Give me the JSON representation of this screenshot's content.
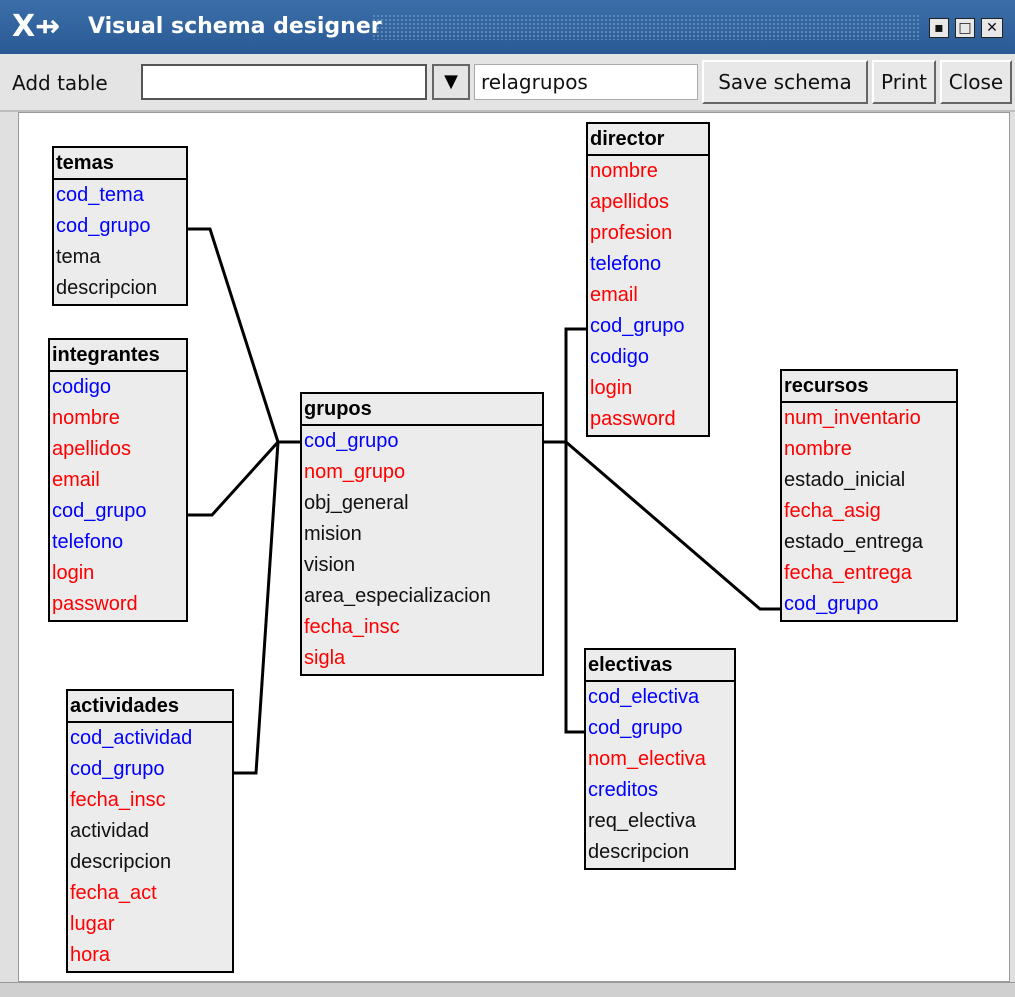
{
  "window": {
    "title": "Visual schema designer",
    "logo": "X⇸",
    "buttons": [
      "▪",
      "□",
      "✕"
    ]
  },
  "toolbar": {
    "add_table_label": "Add table",
    "add_table_value": "",
    "dropdown_icon": "▼",
    "relation_value": "relagrupos",
    "save_label": "Save schema",
    "print_label": "Print",
    "close_label": "Close"
  },
  "colors": {
    "key": "#0000ff",
    "required": "#ff0000",
    "optional": "#111111"
  },
  "tables": [
    {
      "name": "temas",
      "fields": [
        {
          "name": "cod_tema",
          "type": "key"
        },
        {
          "name": "cod_grupo",
          "type": "key"
        },
        {
          "name": "tema",
          "type": "optional"
        },
        {
          "name": "descripcion",
          "type": "optional"
        }
      ]
    },
    {
      "name": "integrantes",
      "fields": [
        {
          "name": "codigo",
          "type": "key"
        },
        {
          "name": "nombre",
          "type": "required"
        },
        {
          "name": "apellidos",
          "type": "required"
        },
        {
          "name": "email",
          "type": "required"
        },
        {
          "name": "cod_grupo",
          "type": "key"
        },
        {
          "name": "telefono",
          "type": "key"
        },
        {
          "name": "login",
          "type": "required"
        },
        {
          "name": "password",
          "type": "required"
        }
      ]
    },
    {
      "name": "actividades",
      "fields": [
        {
          "name": "cod_actividad",
          "type": "key"
        },
        {
          "name": "cod_grupo",
          "type": "key"
        },
        {
          "name": "fecha_insc",
          "type": "required"
        },
        {
          "name": "actividad",
          "type": "optional"
        },
        {
          "name": "descripcion",
          "type": "optional"
        },
        {
          "name": "fecha_act",
          "type": "required"
        },
        {
          "name": "lugar",
          "type": "required"
        },
        {
          "name": "hora",
          "type": "required"
        }
      ]
    },
    {
      "name": "grupos",
      "fields": [
        {
          "name": "cod_grupo",
          "type": "key"
        },
        {
          "name": "nom_grupo",
          "type": "required"
        },
        {
          "name": "obj_general",
          "type": "optional"
        },
        {
          "name": "mision",
          "type": "optional"
        },
        {
          "name": "vision",
          "type": "optional"
        },
        {
          "name": "area_especializacion",
          "type": "optional"
        },
        {
          "name": "fecha_insc",
          "type": "required"
        },
        {
          "name": "sigla",
          "type": "required"
        }
      ]
    },
    {
      "name": "director",
      "fields": [
        {
          "name": "nombre",
          "type": "required"
        },
        {
          "name": "apellidos",
          "type": "required"
        },
        {
          "name": "profesion",
          "type": "required"
        },
        {
          "name": "telefono",
          "type": "key"
        },
        {
          "name": "email",
          "type": "required"
        },
        {
          "name": "cod_grupo",
          "type": "key"
        },
        {
          "name": "codigo",
          "type": "key"
        },
        {
          "name": "login",
          "type": "required"
        },
        {
          "name": "password",
          "type": "required"
        }
      ]
    },
    {
      "name": "recursos",
      "fields": [
        {
          "name": "num_inventario",
          "type": "required"
        },
        {
          "name": "nombre",
          "type": "required"
        },
        {
          "name": "estado_inicial",
          "type": "optional"
        },
        {
          "name": "fecha_asig",
          "type": "required"
        },
        {
          "name": "estado_entrega",
          "type": "optional"
        },
        {
          "name": "fecha_entrega",
          "type": "required"
        },
        {
          "name": "cod_grupo",
          "type": "key"
        }
      ]
    },
    {
      "name": "electivas",
      "fields": [
        {
          "name": "cod_electiva",
          "type": "key"
        },
        {
          "name": "cod_grupo",
          "type": "key"
        },
        {
          "name": "nom_electiva",
          "type": "required"
        },
        {
          "name": "creditos",
          "type": "key"
        },
        {
          "name": "req_electiva",
          "type": "optional"
        },
        {
          "name": "descripcion",
          "type": "optional"
        }
      ]
    }
  ]
}
